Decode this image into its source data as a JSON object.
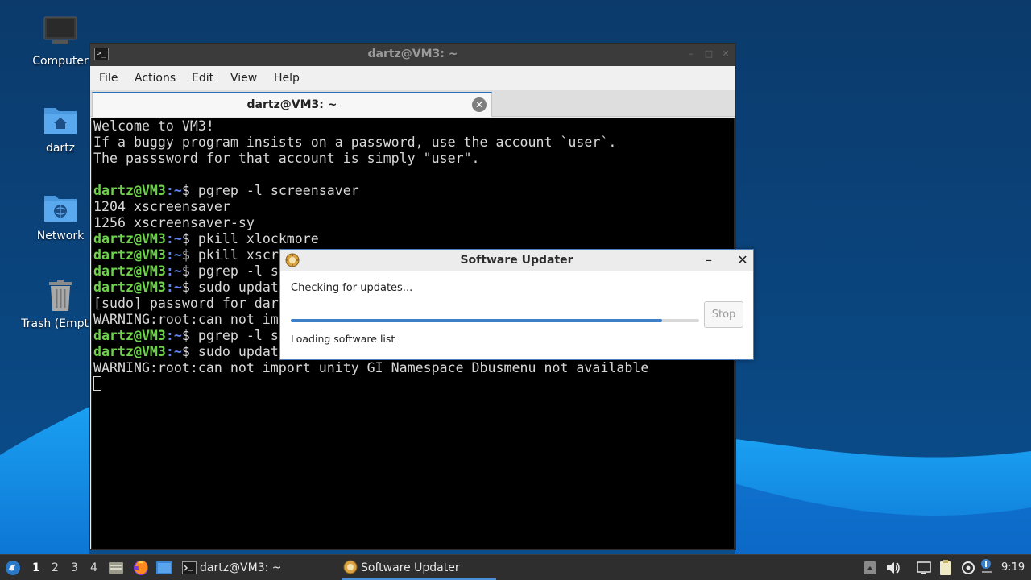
{
  "desktop": {
    "icons": [
      {
        "label": "Computer",
        "icon": "computer-icon"
      },
      {
        "label": "dartz",
        "icon": "home-folder-icon"
      },
      {
        "label": "Network",
        "icon": "network-folder-icon"
      },
      {
        "label": "Trash (Empty)",
        "icon": "trash-icon"
      }
    ]
  },
  "terminal": {
    "title": "dartz@VM3: ~",
    "menu": [
      "File",
      "Actions",
      "Edit",
      "View",
      "Help"
    ],
    "tab_label": "dartz@VM3: ~",
    "prompt_user": "dartz@VM3",
    "prompt_sep": ":",
    "prompt_path": "~",
    "prompt_dollar": "$",
    "lines": [
      {
        "type": "out",
        "text": "Welcome to VM3!"
      },
      {
        "type": "out",
        "text": "If a buggy program insists on a password, use the account `user`."
      },
      {
        "type": "out",
        "text": "The passsword for that account is simply \"user\"."
      },
      {
        "type": "out",
        "text": ""
      },
      {
        "type": "cmd",
        "text": " pgrep -l screensaver"
      },
      {
        "type": "out",
        "text": "1204 xscreensaver"
      },
      {
        "type": "out",
        "text": "1256 xscreensaver-sy"
      },
      {
        "type": "cmd",
        "text": " pkill xlockmore"
      },
      {
        "type": "cmd",
        "text": " pkill xscre"
      },
      {
        "type": "cmd",
        "text": " pgrep -l sc"
      },
      {
        "type": "cmd",
        "text": " sudo update"
      },
      {
        "type": "out",
        "text": "[sudo] password for dart"
      },
      {
        "type": "out",
        "text": "WARNING:root:can not imp"
      },
      {
        "type": "cmd",
        "text": " pgrep -l sc"
      },
      {
        "type": "cmd",
        "text": " sudo update"
      },
      {
        "type": "out",
        "text": "WARNING:root:can not import unity GI Namespace Dbusmenu not available"
      }
    ]
  },
  "updater": {
    "title": "Software Updater",
    "status": "Checking for updates...",
    "progress": 0.91,
    "stop_label": "Stop",
    "detail": "Loading software list",
    "minimize_glyph": "–",
    "close_glyph": "✕"
  },
  "taskbar": {
    "workspaces": [
      "1",
      "2",
      "3",
      "4"
    ],
    "active_workspace": "1",
    "tasks": [
      {
        "label": "dartz@VM3: ~",
        "icon": "terminal-icon"
      },
      {
        "label": "Software Updater",
        "icon": "software-updater-icon"
      }
    ],
    "clock": "9:19"
  },
  "colors": {
    "accent": "#3c80c8",
    "prompt_user": "#6ed24b",
    "prompt_path": "#5f86f0"
  }
}
